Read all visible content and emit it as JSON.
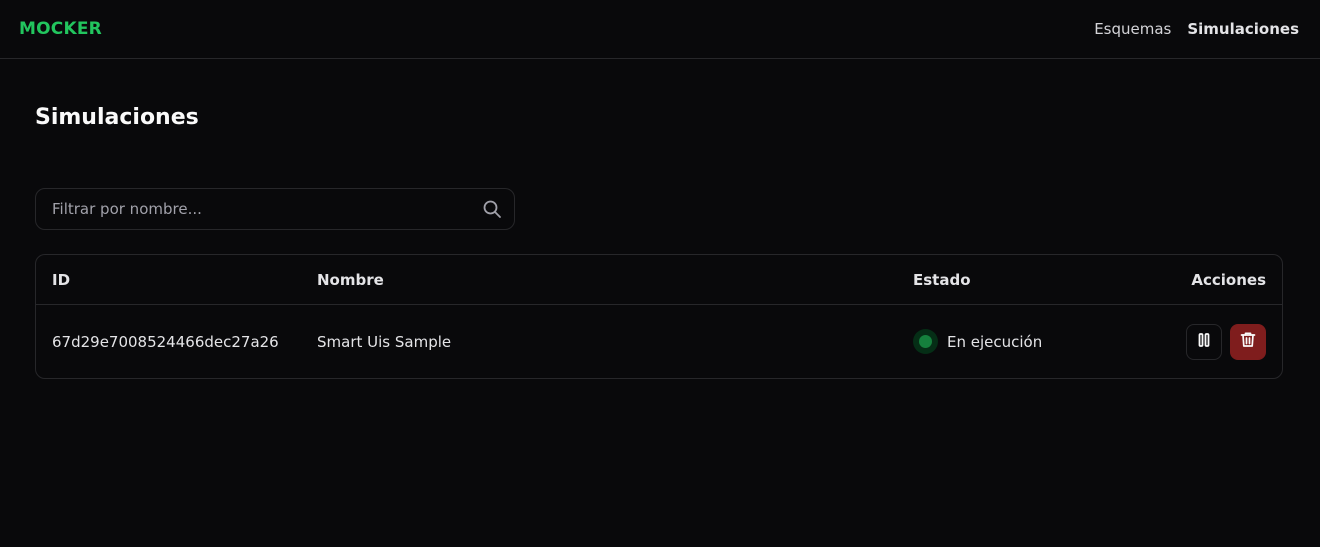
{
  "app": {
    "logo": "MOCKER"
  },
  "nav": {
    "items": [
      {
        "label": "Esquemas"
      },
      {
        "label": "Simulaciones"
      }
    ]
  },
  "page": {
    "title": "Simulaciones"
  },
  "search": {
    "placeholder": "Filtrar por nombre...",
    "value": ""
  },
  "table": {
    "headers": {
      "id": "ID",
      "name": "Nombre",
      "state": "Estado",
      "actions": "Acciones"
    },
    "rows": [
      {
        "id": "67d29e7008524466dec27a26",
        "name": "Smart Uis Sample",
        "state": "En ejecución"
      }
    ]
  },
  "icons": {
    "search": "search-icon",
    "pause": "pause-icon",
    "delete": "trash-icon"
  },
  "colors": {
    "accent": "#22c55e",
    "background": "#09090b",
    "running": "#15803d",
    "danger": "#7f1d1d"
  }
}
